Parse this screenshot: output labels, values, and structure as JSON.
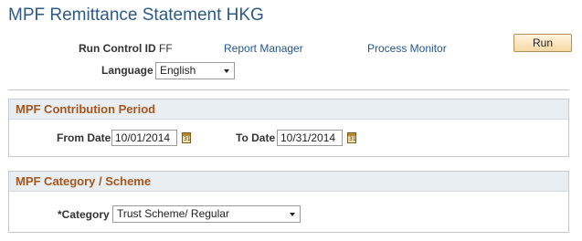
{
  "page": {
    "title": "MPF Remittance Statement HKG"
  },
  "run_control": {
    "label": "Run Control ID",
    "value": "FF",
    "report_manager": "Report Manager",
    "process_monitor": "Process Monitor",
    "run_button": "Run"
  },
  "language": {
    "label": "Language",
    "selected": "English"
  },
  "contribution_period": {
    "title": "MPF Contribution Period",
    "from_label": "From Date",
    "from_value": "10/01/2014",
    "to_label": "To Date",
    "to_value": "10/31/2014",
    "calendar_glyph": "31"
  },
  "category_scheme": {
    "title": "MPF Category / Scheme",
    "category_label": "*Category",
    "category_selected": "Trust Scheme/ Regular"
  }
}
